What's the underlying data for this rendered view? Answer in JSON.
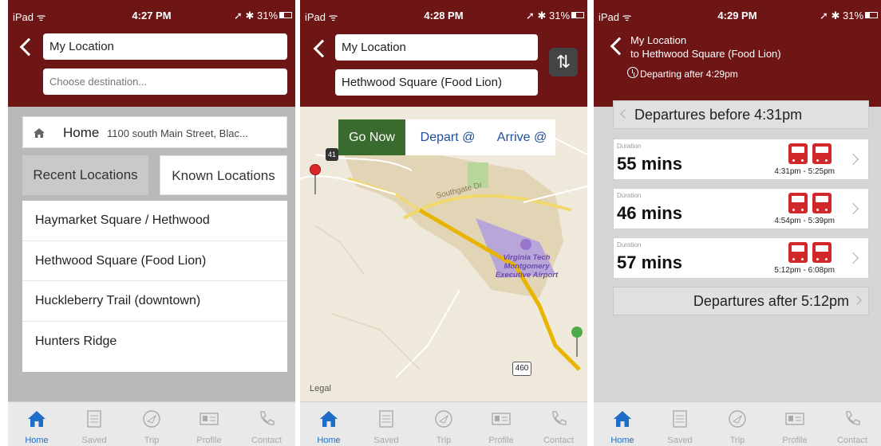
{
  "colors": {
    "maroon": "#6e1515",
    "tab_active": "#1e6ec8",
    "go_now": "#3a6b2e",
    "bus": "#d0282b"
  },
  "tabbar": [
    {
      "label": "Home",
      "icon": "home-icon"
    },
    {
      "label": "Saved",
      "icon": "list-icon"
    },
    {
      "label": "Trip",
      "icon": "compass-icon"
    },
    {
      "label": "Profile",
      "icon": "id-card-icon"
    },
    {
      "label": "Contact",
      "icon": "phone-icon"
    }
  ],
  "screens": [
    {
      "status": {
        "device": "iPad ᯤ",
        "time": "4:27 PM",
        "battery": "➚ ✱ 31%"
      },
      "origin": "My Location",
      "destination_placeholder": "Choose destination...",
      "home": {
        "label": "Home",
        "address": "1100 south Main Street, Blac..."
      },
      "tabs": {
        "recent": "Recent Locations",
        "known": "Known Locations"
      },
      "locations": [
        "Haymarket Square / Hethwood",
        "Hethwood Square (Food Lion)",
        "Huckleberry Trail (downtown)",
        "Hunters Ridge"
      ],
      "active_tab": "Home"
    },
    {
      "status": {
        "device": "iPad ᯤ",
        "time": "4:28 PM",
        "battery": "➚ ✱ 31%"
      },
      "origin": "My Location",
      "destination": "Hethwood Square (Food Lion)",
      "swap_icon": "swap-icon",
      "segments": {
        "go": "Go Now",
        "depart": "Depart @",
        "arrive": "Arrive @"
      },
      "map": {
        "road_label": "Southgate Dr",
        "airport_line1": "Virginia Tech",
        "airport_line2": "Montgomery",
        "airport_line3": "Executive Airport",
        "shield_460": "460",
        "shield_41": "41",
        "legal": "Legal"
      },
      "active_tab": "Home"
    },
    {
      "status": {
        "device": "iPad ᯤ",
        "time": "4:29 PM",
        "battery": "➚ ✱ 31%"
      },
      "title_line1": "My Location",
      "title_line2": "to Hethwood Square (Food Lion)",
      "departing": "Departing after 4:29pm",
      "before": "Departures before 4:31pm",
      "after": "Departures after 5:12pm",
      "duration_label": "Duration",
      "trips": [
        {
          "duration": "55 mins",
          "times": "4:31pm - 5:25pm"
        },
        {
          "duration": "46 mins",
          "times": "4:54pm - 5:39pm"
        },
        {
          "duration": "57 mins",
          "times": "5:12pm - 6:08pm"
        }
      ],
      "active_tab": "Home"
    }
  ]
}
